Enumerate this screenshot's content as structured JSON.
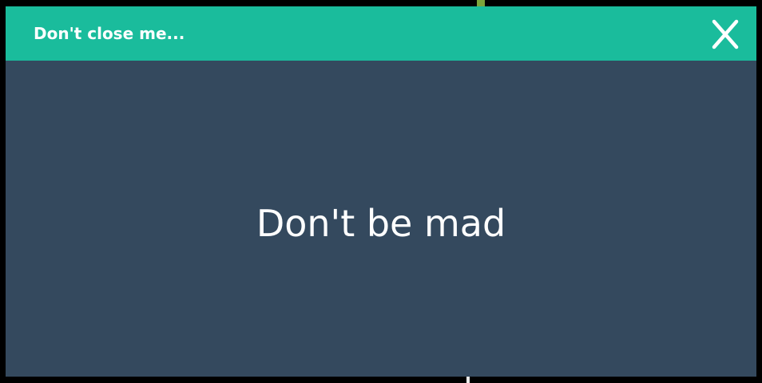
{
  "dialog": {
    "title": "Don't close me...",
    "message": "Don't be mad",
    "close_label": "X",
    "close_icon": "close-icon"
  },
  "colors": {
    "titlebar": "#1abc9c",
    "body": "#34495e",
    "text": "#ffffff",
    "backdrop": "#000000"
  }
}
